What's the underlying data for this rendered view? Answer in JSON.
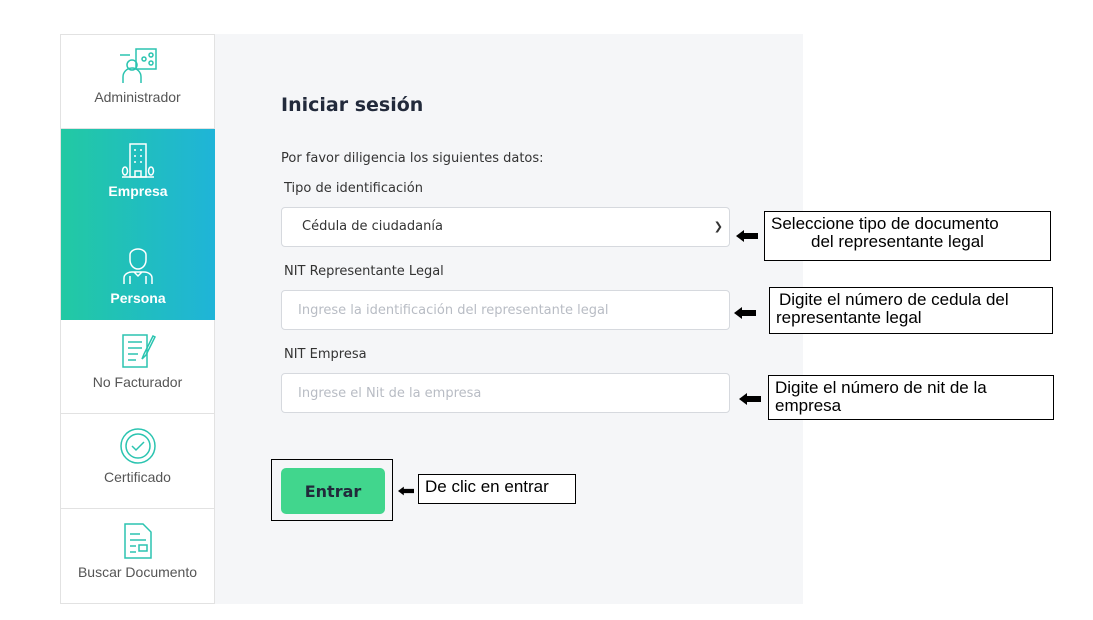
{
  "sidebar": {
    "items": [
      {
        "label": "Administrador",
        "icon": "admin-network-icon"
      },
      {
        "label": "Empresa",
        "icon": "building-icon",
        "active": true
      },
      {
        "label": "Persona",
        "icon": "person-icon",
        "active": true
      },
      {
        "label": "No Facturador",
        "icon": "document-pen-icon"
      },
      {
        "label": "Certificado",
        "icon": "certificate-check-icon"
      },
      {
        "label": "Buscar Documento",
        "icon": "search-document-icon"
      }
    ],
    "active_gradient": [
      "#22c9a3",
      "#1fb4d8"
    ]
  },
  "form": {
    "title": "Iniciar sesión",
    "intro": "Por favor diligencia los siguientes datos:",
    "id_type_label": "Tipo de identificación",
    "id_type_value": "Cédula de ciudadanía",
    "nit_rep_label": "NIT Representante Legal",
    "nit_rep_placeholder": "Ingrese la identificación del representante legal",
    "nit_emp_label": "NIT Empresa",
    "nit_emp_placeholder": "Ingrese el Nit de la empresa",
    "submit": "Entrar",
    "submit_color": "#41d68d"
  },
  "callouts": {
    "c1a": "Seleccione tipo de documento",
    "c1b": "del representante legal",
    "c2a": "Digite el número de cedula del",
    "c2b": "representante legal",
    "c3a": "Digite el número de nit de la",
    "c3b": "empresa",
    "c4": "De clic en entrar"
  }
}
